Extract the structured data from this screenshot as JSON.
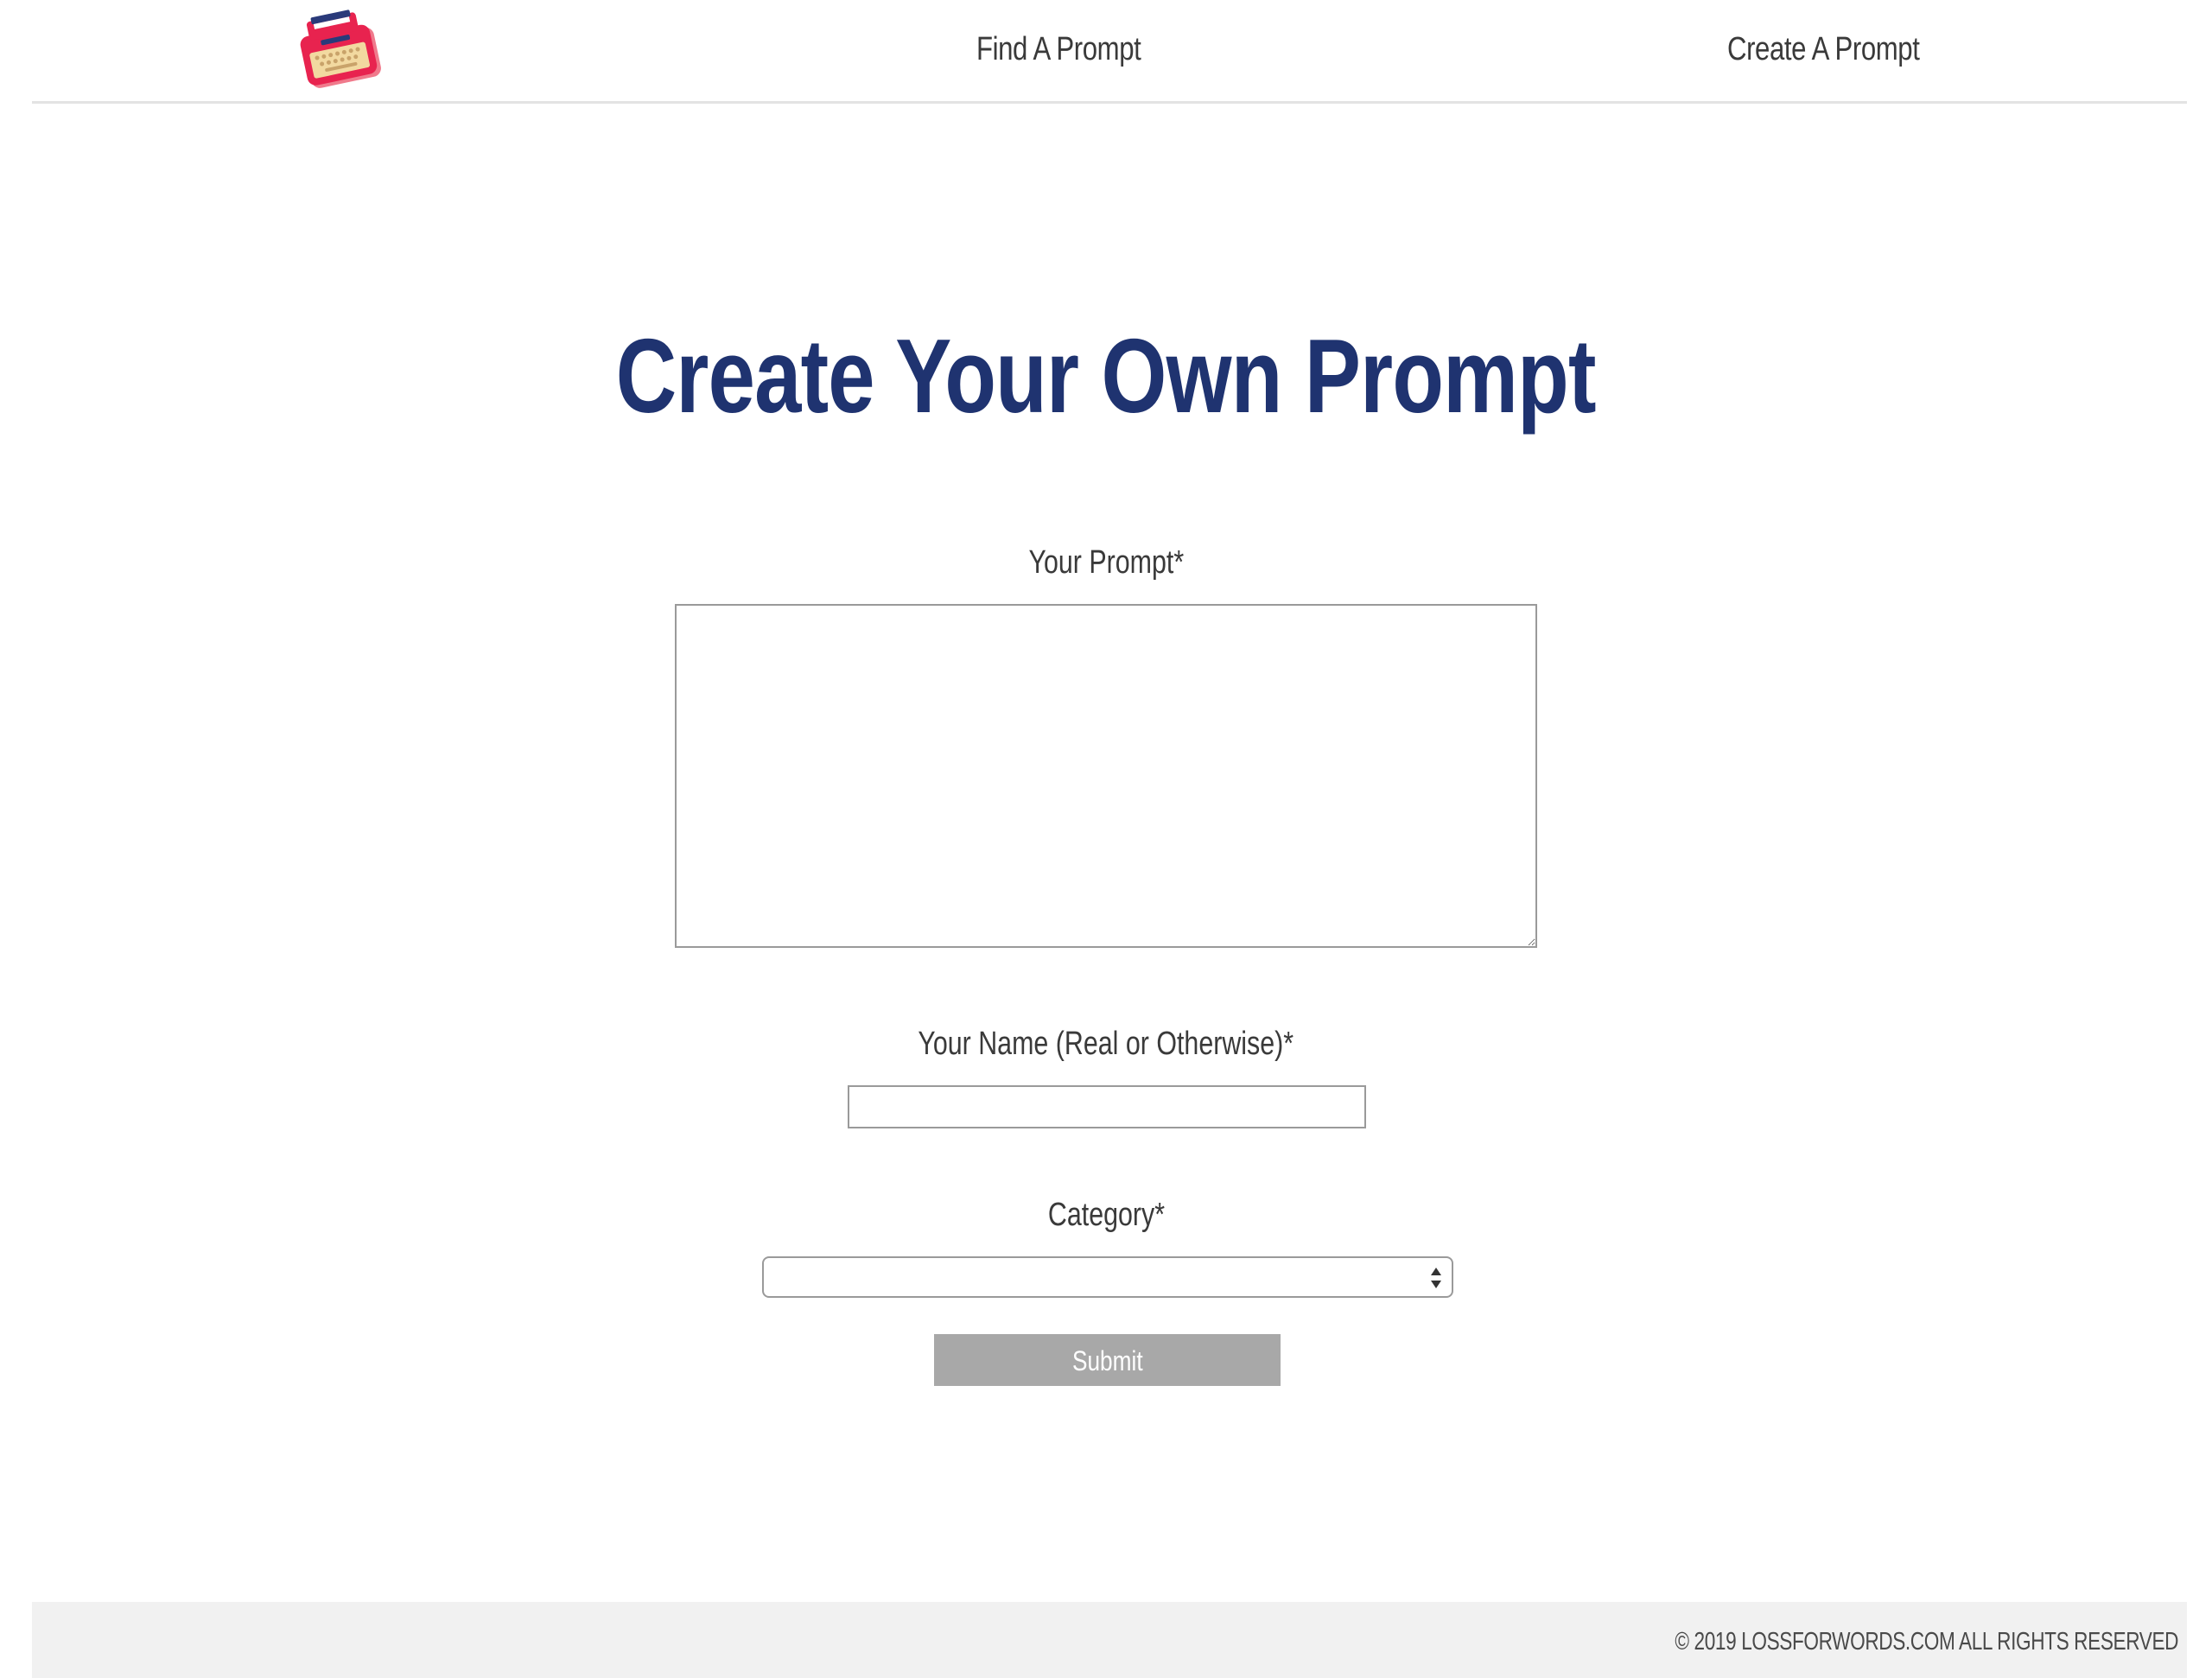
{
  "header": {
    "logo_icon": "typewriter-icon",
    "nav": [
      {
        "label": "Find A Prompt"
      },
      {
        "label": "Create A Prompt"
      }
    ]
  },
  "main": {
    "title": "Create Your Own Prompt",
    "form": {
      "prompt_label": "Your Prompt*",
      "prompt_value": "",
      "name_label": "Your Name (Real or Otherwise)*",
      "name_value": "",
      "category_label": "Category*",
      "category_selected": "",
      "submit_label": "Submit"
    }
  },
  "footer": {
    "copyright": "© 2019 LOSSFORWORDS.COM ALL RIGHTS RESERVED"
  },
  "colors": {
    "title": "#1f3370",
    "button_bg": "#a8a8a8",
    "footer_bg": "#f1f1f1",
    "logo_red": "#e8234f",
    "logo_cream": "#f2d9a0"
  }
}
